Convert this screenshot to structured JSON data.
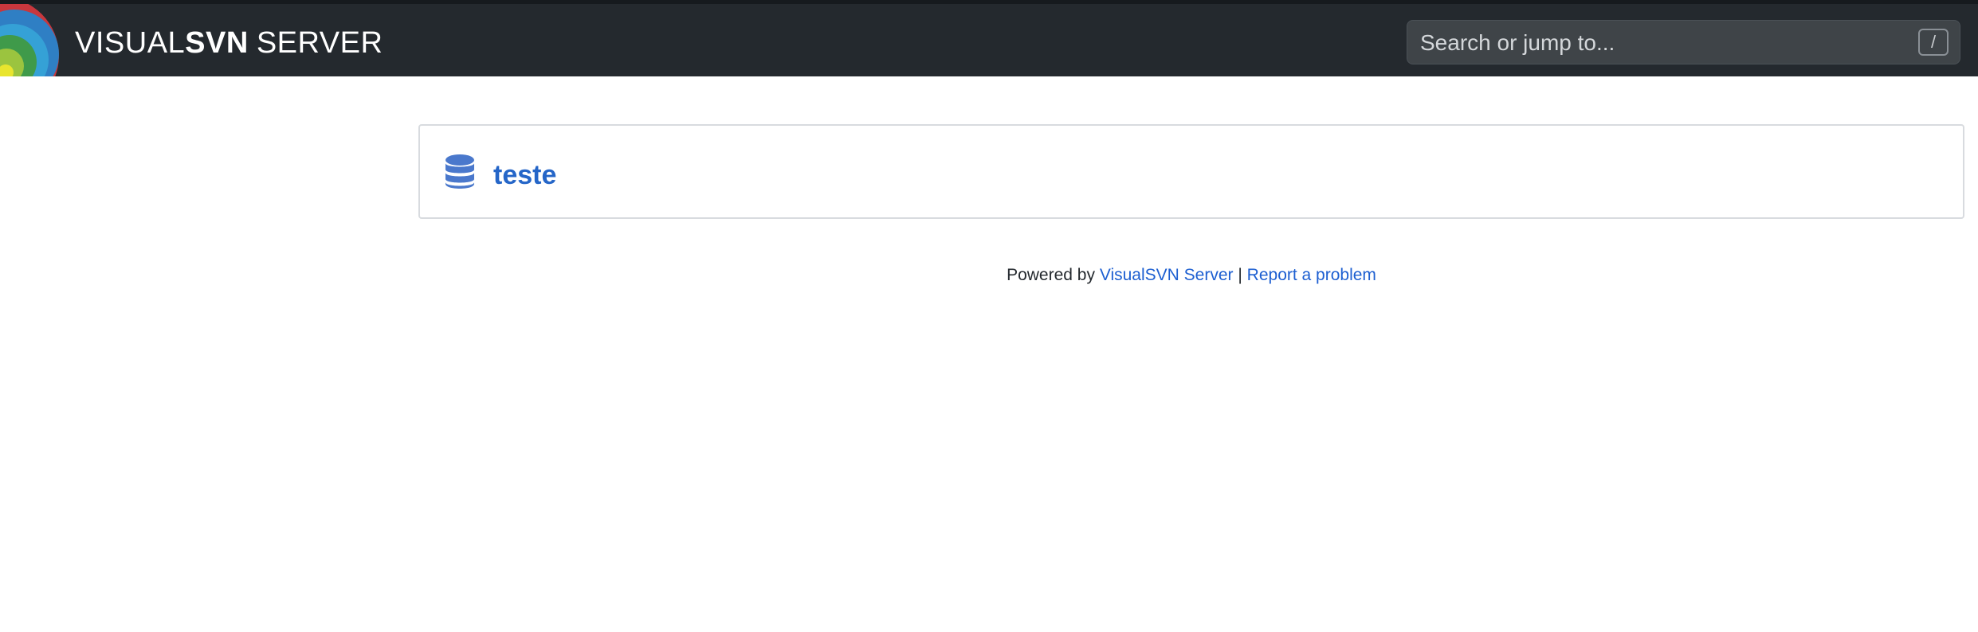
{
  "header": {
    "brand_light": "VISUAL",
    "brand_bold": "SVN",
    "brand_suffix": "SERVER",
    "search": {
      "placeholder": "Search or jump to...",
      "shortcut_key": "/"
    }
  },
  "repositories": [
    {
      "name": "teste",
      "icon": "database-icon"
    }
  ],
  "footer": {
    "powered_by": "Powered by",
    "product_link": "VisualSVN Server",
    "separator": "|",
    "report_link": "Report a problem"
  },
  "colors": {
    "topbar_bg": "#24292e",
    "link": "#2566c8",
    "icon": "#4a78cc"
  }
}
